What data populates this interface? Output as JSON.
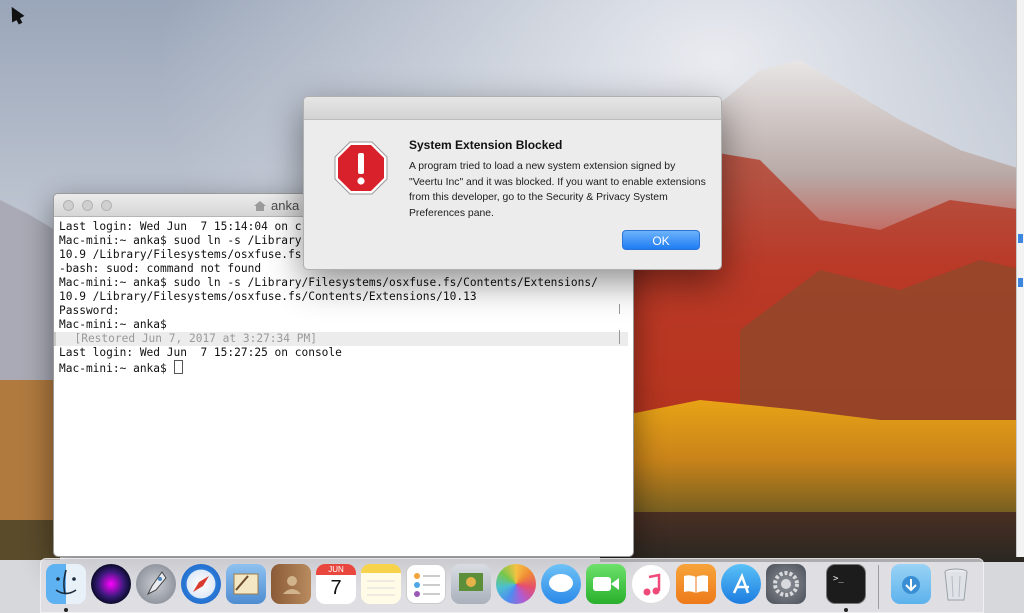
{
  "desktop": {
    "wallpaper": "High Sierra mountain landscape"
  },
  "terminal": {
    "title": "anka",
    "lines": [
      "Last login: Wed Jun  7 15:14:04 on c",
      "Mac-mini:~ anka$ suod ln -s /Library",
      "10.9 /Library/Filesystems/osxfuse.fs",
      "-bash: suod: command not found",
      "Mac-mini:~ anka$ sudo ln -s /Library/Filesystems/osxfuse.fs/Contents/Extensions/",
      "10.9 /Library/Filesystems/osxfuse.fs/Contents/Extensions/10.13",
      "Password:",
      "Mac-mini:~ anka$"
    ],
    "restored_line": "  [Restored Jun 7, 2017 at 3:27:34 PM]",
    "lines_after": [
      "Last login: Wed Jun  7 15:27:25 on console"
    ],
    "prompt": "Mac-mini:~ anka$ "
  },
  "alert": {
    "title": "System Extension Blocked",
    "message": "A program tried to load a new system extension signed by \"Veertu Inc\" and it was blocked.  If you want to enable extensions from this developer, go to the Security & Privacy System Preferences pane.",
    "ok_label": "OK",
    "icon": "stop-sign-icon",
    "accent": "#1e7cf4",
    "stop_color": "#d9212c"
  },
  "calendar_icon": {
    "month": "JUN",
    "day": "7"
  },
  "dock": {
    "items": [
      {
        "name": "finder",
        "running": true
      },
      {
        "name": "siri",
        "running": false
      },
      {
        "name": "launchpad",
        "running": false
      },
      {
        "name": "safari",
        "running": false
      },
      {
        "name": "mail",
        "running": false
      },
      {
        "name": "contacts",
        "running": false
      },
      {
        "name": "calendar",
        "running": false
      },
      {
        "name": "notes",
        "running": false
      },
      {
        "name": "reminders",
        "running": false
      },
      {
        "name": "photo-booth",
        "running": false
      },
      {
        "name": "photos",
        "running": false
      },
      {
        "name": "messages",
        "running": false
      },
      {
        "name": "facetime",
        "running": false
      },
      {
        "name": "itunes",
        "running": false
      },
      {
        "name": "ibooks",
        "running": false
      },
      {
        "name": "app-store",
        "running": false
      },
      {
        "name": "system-preferences",
        "running": false
      },
      {
        "name": "terminal",
        "running": true
      },
      {
        "name": "downloads",
        "running": false
      },
      {
        "name": "trash",
        "running": false
      }
    ]
  }
}
